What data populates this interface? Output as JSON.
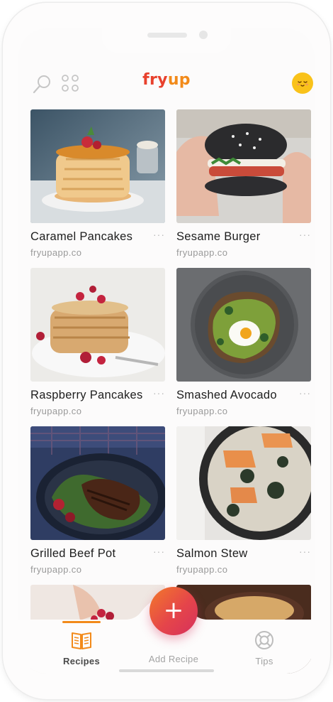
{
  "app": {
    "logo_part1": "fry",
    "logo_part2": "up",
    "brand_colors": {
      "red": "#e8412d",
      "orange": "#f28a1a"
    }
  },
  "header": {
    "search_icon": "search-icon",
    "grid_icon": "grid-icon",
    "avatar_icon": "smiley-avatar"
  },
  "recipes": [
    {
      "title": "Caramel Pancakes",
      "source": "fryupapp.co",
      "more": "···"
    },
    {
      "title": "Sesame Burger",
      "source": "fryupapp.co",
      "more": "···"
    },
    {
      "title": "Raspberry Pancakes",
      "source": "fryupapp.co",
      "more": "···"
    },
    {
      "title": "Smashed Avocado",
      "source": "fryupapp.co",
      "more": "···"
    },
    {
      "title": "Grilled Beef Pot",
      "source": "fryupapp.co",
      "more": "···"
    },
    {
      "title": "Salmon Stew",
      "source": "fryupapp.co",
      "more": "···"
    }
  ],
  "fab": {
    "label": "+"
  },
  "tabs": [
    {
      "label": "Recipes",
      "icon": "book-icon",
      "active": true
    },
    {
      "label": "Add Recipe",
      "icon": "",
      "active": false
    },
    {
      "label": "Tips",
      "icon": "lifebuoy-icon",
      "active": false
    }
  ]
}
